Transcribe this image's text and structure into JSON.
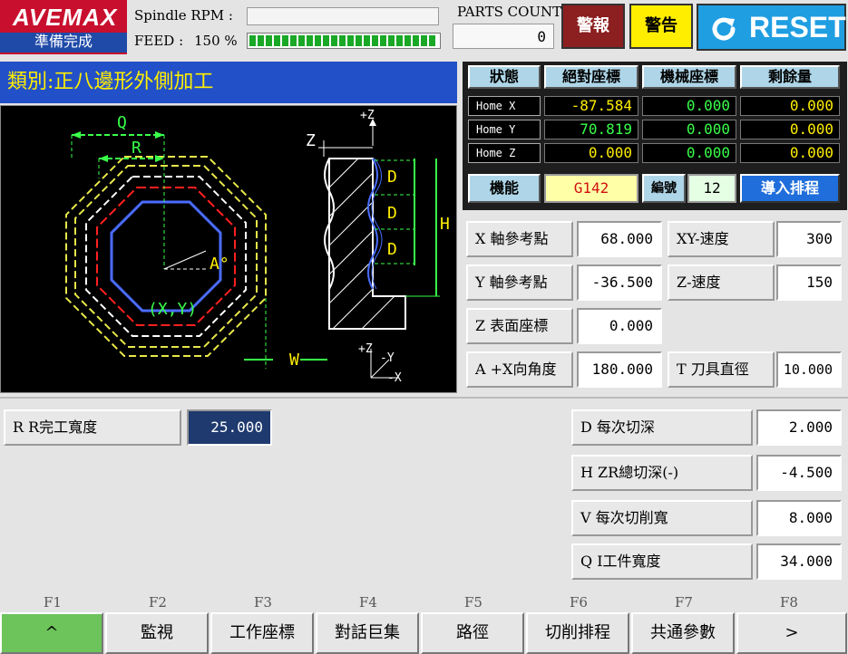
{
  "brand": {
    "logo": "AVEMAX",
    "status": "準備完成"
  },
  "top": {
    "spindle_label": "Spindle RPM :",
    "feed_label": "FEED :",
    "feed_value": "150 %",
    "feed_fill": 0.97,
    "parts_label": "PARTS COUNT",
    "parts_value": "0",
    "alarm": "警報",
    "warning": "警告",
    "reset": "RESET"
  },
  "category": "類別:正八邊形外側加工",
  "drawing": {
    "q": "Q",
    "r": "R",
    "a": "A°",
    "xy": "(X,Y)",
    "w": "W",
    "z": "Z",
    "zplus": "+Z",
    "d1": "D",
    "d2": "D",
    "d3": "D",
    "h": "H",
    "ax_z": "+Z",
    "ax_y": "-Y",
    "ax_x": "-X"
  },
  "status_table": {
    "headers": [
      "狀態",
      "絕對座標",
      "機械座標",
      "剩餘量"
    ],
    "rows": [
      {
        "label": "Home X",
        "abs": "-87.584",
        "mach": "0.000",
        "rem": "0.000"
      },
      {
        "label": "Home Y",
        "abs": "70.819",
        "mach": "0.000",
        "rem": "0.000"
      },
      {
        "label": "Home Z",
        "abs": "0.000",
        "mach": "0.000",
        "rem": "0.000"
      }
    ],
    "func_label": "機能",
    "func_value": "G142",
    "num_label": "編號",
    "num_value": "12",
    "import_btn": "導入排程"
  },
  "params": {
    "x_ref": {
      "label": "X 軸參考點",
      "value": "68.000"
    },
    "xy_speed": {
      "label": "XY-速度",
      "value": "300"
    },
    "y_ref": {
      "label": "Y 軸參考點",
      "value": "-36.500"
    },
    "z_speed": {
      "label": "Z-速度",
      "value": "150"
    },
    "z_surface": {
      "label": "Z 表面座標",
      "value": "0.000"
    },
    "a_angle": {
      "label": "A +X向角度",
      "value": "180.000"
    },
    "t_dia": {
      "label": "T 刀具直徑",
      "value": "10.000"
    }
  },
  "lower": {
    "r_width": {
      "label": "R R完工寬度",
      "value": "25.000"
    },
    "d_cut": {
      "label": "D 每次切深",
      "value": "2.000"
    },
    "h_total": {
      "label": "H ZR總切深(-)",
      "value": "-4.500"
    },
    "v_width": {
      "label": "V 每次切削寬",
      "value": "8.000"
    },
    "q_width": {
      "label": "Q I工件寬度",
      "value": "34.000"
    }
  },
  "fkeys": [
    {
      "fn": "F1",
      "label": "^"
    },
    {
      "fn": "F2",
      "label": "監視"
    },
    {
      "fn": "F3",
      "label": "工作座標"
    },
    {
      "fn": "F4",
      "label": "對話巨集"
    },
    {
      "fn": "F5",
      "label": "路徑"
    },
    {
      "fn": "F6",
      "label": "切削排程"
    },
    {
      "fn": "F7",
      "label": "共通參數"
    },
    {
      "fn": "F8",
      "label": ">"
    }
  ],
  "colors": {
    "reset": "#1f9ee2",
    "alarm": "#8c1f1f",
    "warning": "#ffee00",
    "category": "#2250c8",
    "active_fkey": "#6cc45a",
    "selected_value": "#1e3a6e"
  }
}
